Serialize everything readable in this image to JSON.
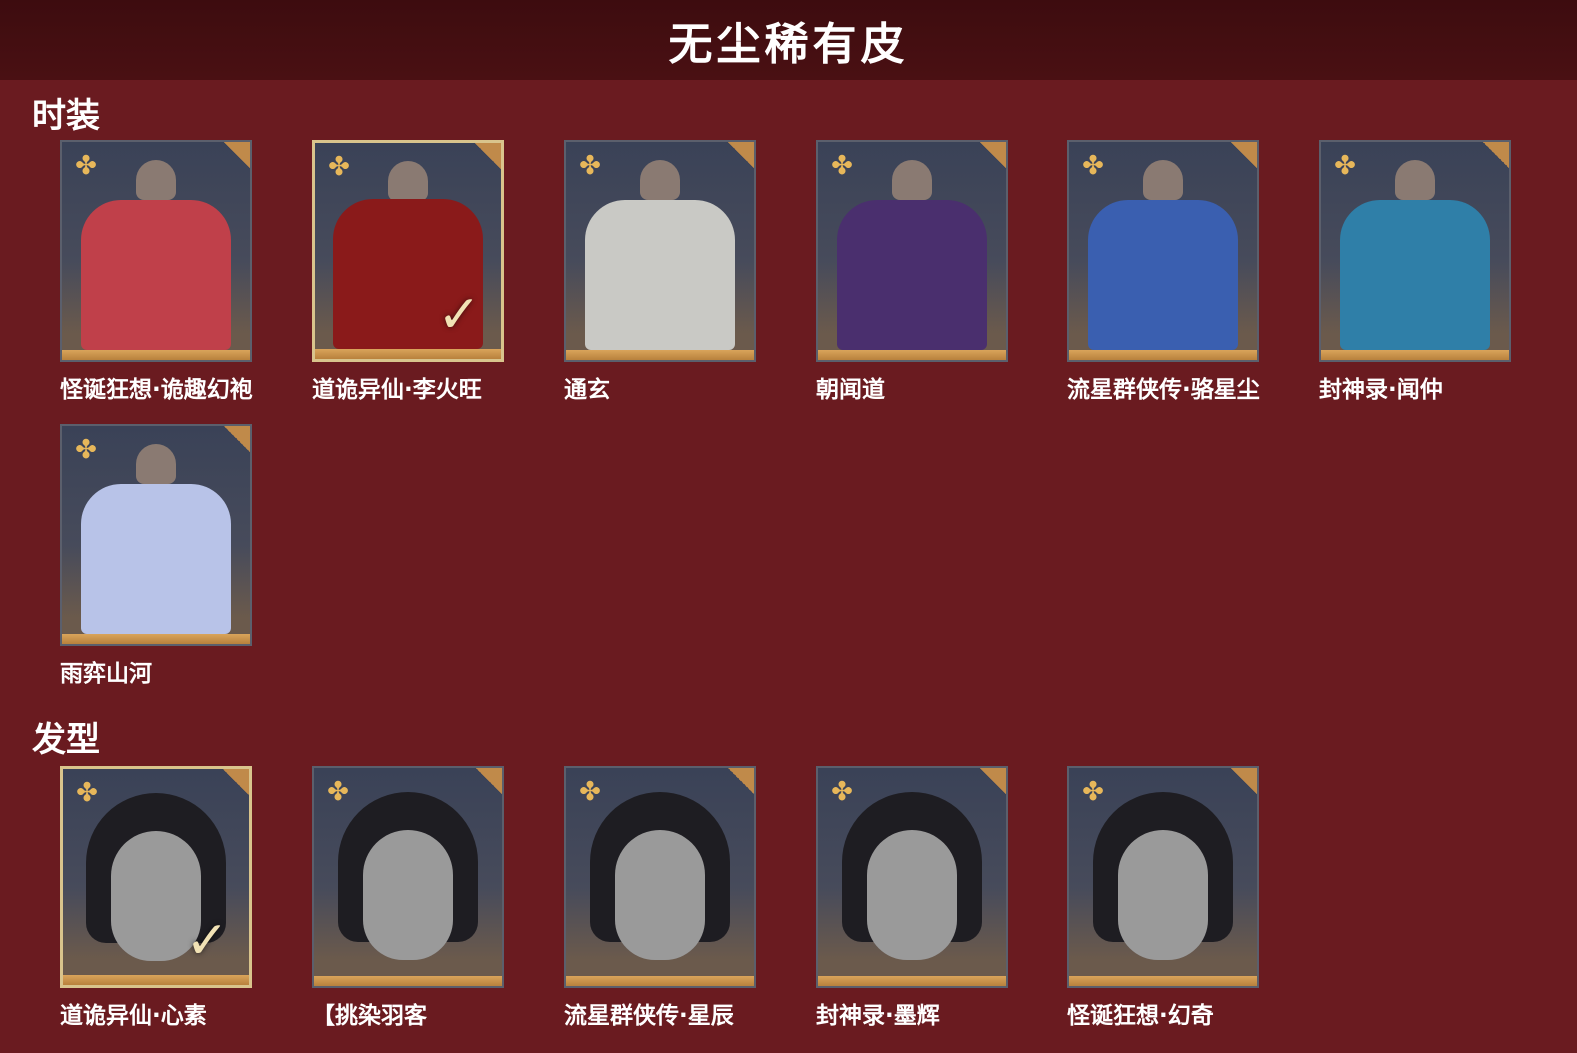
{
  "page": {
    "title": "无尘稀有皮"
  },
  "sections": {
    "outfits": {
      "title": "时装",
      "items": [
        {
          "name": "怪诞狂想·诡趣幻袍",
          "selected": false,
          "color": "#c0404a"
        },
        {
          "name": "道诡异仙·李火旺",
          "selected": true,
          "color": "#8a1a1a"
        },
        {
          "name": "通玄",
          "selected": false,
          "color": "#c9c9c5"
        },
        {
          "name": "朝闻道",
          "selected": false,
          "color": "#4a2f6e"
        },
        {
          "name": "流星群侠传·骆星尘",
          "selected": false,
          "color": "#3a5fb0"
        },
        {
          "name": "封神录·闻仲",
          "selected": false,
          "color": "#2f7fa8"
        },
        {
          "name": "雨弈山河",
          "selected": false,
          "color": "#b8c3e8"
        }
      ]
    },
    "hairstyles": {
      "title": "发型",
      "items": [
        {
          "name": "道诡异仙·心素",
          "selected": true
        },
        {
          "name": "【挑染羽客",
          "selected": false
        },
        {
          "name": "流星群侠传·星辰",
          "selected": false
        },
        {
          "name": "封神录·墨辉",
          "selected": false
        },
        {
          "name": "怪诞狂想·幻奇",
          "selected": false
        }
      ]
    }
  },
  "icons": {
    "rarity": "four-petal-flower-icon",
    "corner": "corner-leaf-icon",
    "check": "checkmark-icon"
  },
  "symbols": {
    "rarity": "✤",
    "check": "✓"
  }
}
